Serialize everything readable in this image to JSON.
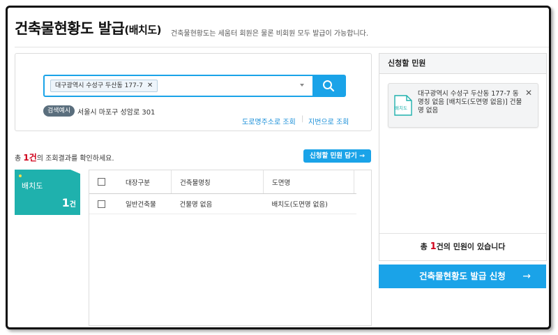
{
  "header": {
    "title": "건축물현황도 발급",
    "title_suffix": "(배치도)",
    "description": "건축물현황도는 세움터 회원은 물론 비회원 모두 발급이 가능합니다."
  },
  "search": {
    "selected_address": "대구광역시 수성구 두산동 177-7",
    "example_badge": "검색예시",
    "example_text": "서울시 마포구 성암로 301",
    "road_link": "도로명주소로 조회",
    "lot_link": "지번으로 조회"
  },
  "results": {
    "count_prefix": "총 ",
    "count_num": "1건",
    "count_suffix": "의 조회결과를 확인하세요.",
    "cart_button": "신청할 민원 담기 →",
    "type_card": {
      "label": "배치도",
      "count": "1",
      "unit": "건"
    },
    "table": {
      "headers": [
        "대장구분",
        "건축물명칭",
        "도면명"
      ],
      "rows": [
        [
          "일반건축물",
          "건물명 없음",
          "배치도(도면명 없음)"
        ]
      ]
    }
  },
  "request_panel": {
    "title": "신청할 민원",
    "item": {
      "icon_label": "배치도",
      "text": "대구광역시 수성구 두산동 177-7 동명칭 없음 [배치도(도면명 없음)] 건물명 없음"
    },
    "footer_prefix": "총 ",
    "footer_num": "1",
    "footer_suffix": "건의 민원이 있습니다",
    "apply_button": "건축물현황도 발급 신청",
    "apply_arrow": "→"
  },
  "colors": {
    "accent_blue": "#1aa3e8",
    "teal_card": "#1fb1ad",
    "count_red": "#d0021b"
  },
  "icons": [
    "search-icon",
    "close-icon",
    "chevron-down-icon",
    "document-icon",
    "arrow-right-icon"
  ]
}
